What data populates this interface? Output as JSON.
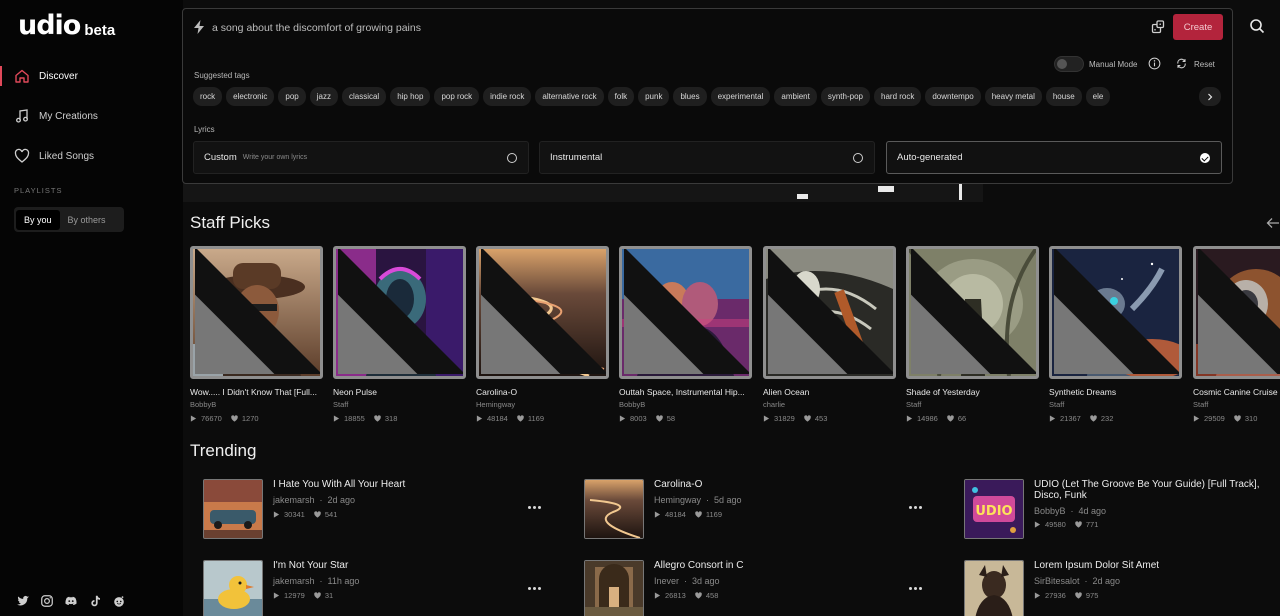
{
  "app": {
    "logo": "udio",
    "badge": "beta"
  },
  "sidebar": {
    "items": [
      {
        "label": "Discover",
        "icon": "home-icon",
        "active": true
      },
      {
        "label": "My Creations",
        "icon": "music-note-icon",
        "active": false
      },
      {
        "label": "Liked Songs",
        "icon": "heart-icon",
        "active": false
      }
    ],
    "playlists_label": "PLAYLISTS",
    "playlist_tabs": [
      "By you",
      "By others"
    ],
    "socials": [
      "twitter-icon",
      "instagram-icon",
      "discord-icon",
      "tiktok-icon",
      "reddit-icon"
    ]
  },
  "prompt": {
    "text": "a song about the discomfort of growing pains",
    "create_label": "Create",
    "suggested_label": "Suggested tags",
    "manual_mode_label": "Manual Mode",
    "reset_label": "Reset",
    "tags": [
      "rock",
      "electronic",
      "pop",
      "jazz",
      "classical",
      "hip hop",
      "pop rock",
      "indie rock",
      "alternative rock",
      "folk",
      "punk",
      "blues",
      "experimental",
      "ambient",
      "synth-pop",
      "hard rock",
      "downtempo",
      "heavy metal",
      "house",
      "ele"
    ],
    "lyrics_label": "Lyrics",
    "lyrics_options": [
      {
        "label": "Custom",
        "sub": "Write your own lyrics",
        "selected": false
      },
      {
        "label": "Instrumental",
        "sub": "",
        "selected": false
      },
      {
        "label": "Auto-generated",
        "sub": "",
        "selected": true
      }
    ]
  },
  "staff_picks": {
    "title": "Staff Picks",
    "cards": [
      {
        "title": "Wow..... I Didn't Know That [Full...",
        "artist": "BobbyB",
        "plays": "76670",
        "likes": "1270"
      },
      {
        "title": "Neon Pulse",
        "artist": "Staff",
        "plays": "18855",
        "likes": "318"
      },
      {
        "title": "Carolina-O",
        "artist": "Hemingway",
        "plays": "48184",
        "likes": "1169"
      },
      {
        "title": "Outtah Space, Instrumental Hip...",
        "artist": "BobbyB",
        "plays": "8003",
        "likes": "58"
      },
      {
        "title": "Alien Ocean",
        "artist": "charlie",
        "plays": "31829",
        "likes": "453"
      },
      {
        "title": "Shade of Yesterday",
        "artist": "Staff",
        "plays": "14986",
        "likes": "66"
      },
      {
        "title": "Synthetic Dreams",
        "artist": "Staff",
        "plays": "21367",
        "likes": "232"
      },
      {
        "title": "Cosmic Canine Cruise",
        "artist": "Staff",
        "plays": "29509",
        "likes": "310"
      }
    ]
  },
  "trending": {
    "title": "Trending",
    "items": [
      {
        "title": "I Hate You With All Your Heart",
        "artist": "jakemarsh",
        "age": "2d ago",
        "plays": "30341",
        "likes": "541"
      },
      {
        "title": "Carolina-O",
        "artist": "Hemingway",
        "age": "5d ago",
        "plays": "48184",
        "likes": "1169"
      },
      {
        "title": "UDIO (Let The Groove Be Your Guide) [Full Track], Disco, Funk",
        "artist": "BobbyB",
        "age": "4d ago",
        "plays": "49580",
        "likes": "771"
      },
      {
        "title": "I'm Not Your Star",
        "artist": "jakemarsh",
        "age": "11h ago",
        "plays": "12979",
        "likes": "31"
      },
      {
        "title": "Allegro Consort in C",
        "artist": "Inever",
        "age": "3d ago",
        "plays": "26813",
        "likes": "458"
      },
      {
        "title": "Lorem Ipsum Dolor Sit Amet",
        "artist": "SirBitesalot",
        "age": "2d ago",
        "plays": "27936",
        "likes": "975"
      }
    ]
  },
  "colors": {
    "accent": "#b3243c",
    "active_marker": "#e0495a",
    "background": "#000000"
  }
}
